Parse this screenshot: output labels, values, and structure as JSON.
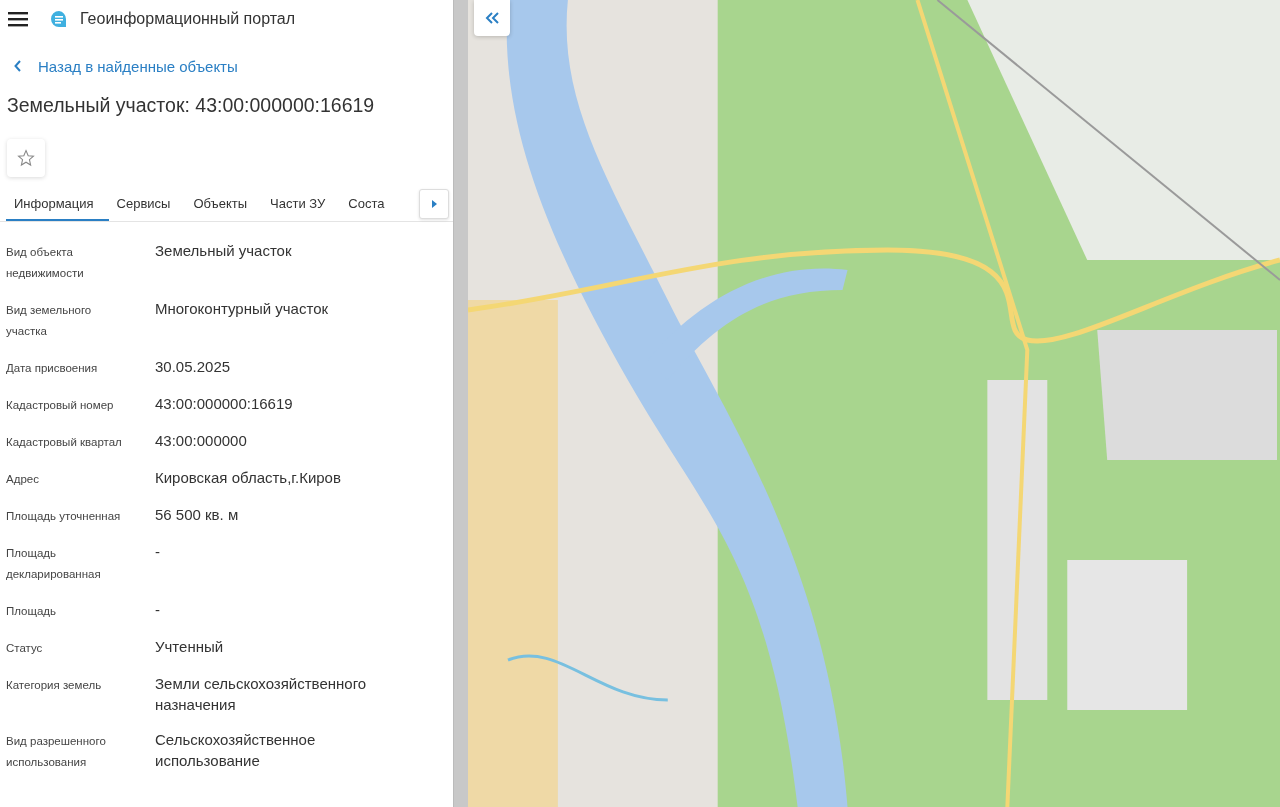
{
  "header": {
    "title": "Геоинформационный портал"
  },
  "back_link": "Назад в найденные объекты",
  "heading": "Земельный участок: 43:00:000000:16619",
  "favorite": {
    "selected": false
  },
  "tabs": [
    {
      "label": "Информация",
      "selected": true
    },
    {
      "label": "Сервисы",
      "selected": false
    },
    {
      "label": "Объекты",
      "selected": false
    },
    {
      "label": "Части ЗУ",
      "selected": false
    },
    {
      "label": "Соста",
      "selected": false
    }
  ],
  "properties": [
    {
      "label": "Вид объекта недвижимости",
      "value": "Земельный участок"
    },
    {
      "label": "Вид земельного участка",
      "value": "Многоконтурный участок"
    },
    {
      "label": "Дата присвоения",
      "value": "30.05.2025"
    },
    {
      "label": "Кадастровый номер",
      "value": "43:00:000000:16619"
    },
    {
      "label": "Кадастровый квартал",
      "value": "43:00:000000"
    },
    {
      "label": "Адрес",
      "value": "Кировская область,г.Киров"
    },
    {
      "label": "Площадь уточненная",
      "value": "56 500 кв. м"
    },
    {
      "label": "Площадь декларированная",
      "value": "-"
    },
    {
      "label": "Площадь",
      "value": "-"
    },
    {
      "label": "Статус",
      "value": "Учтенный"
    },
    {
      "label": "Категория земель",
      "value": "Земли сельскохозяйственного назначения"
    },
    {
      "label": "Вид разрешенного использования",
      "value": "Сельскохозяйственное использование"
    }
  ]
}
